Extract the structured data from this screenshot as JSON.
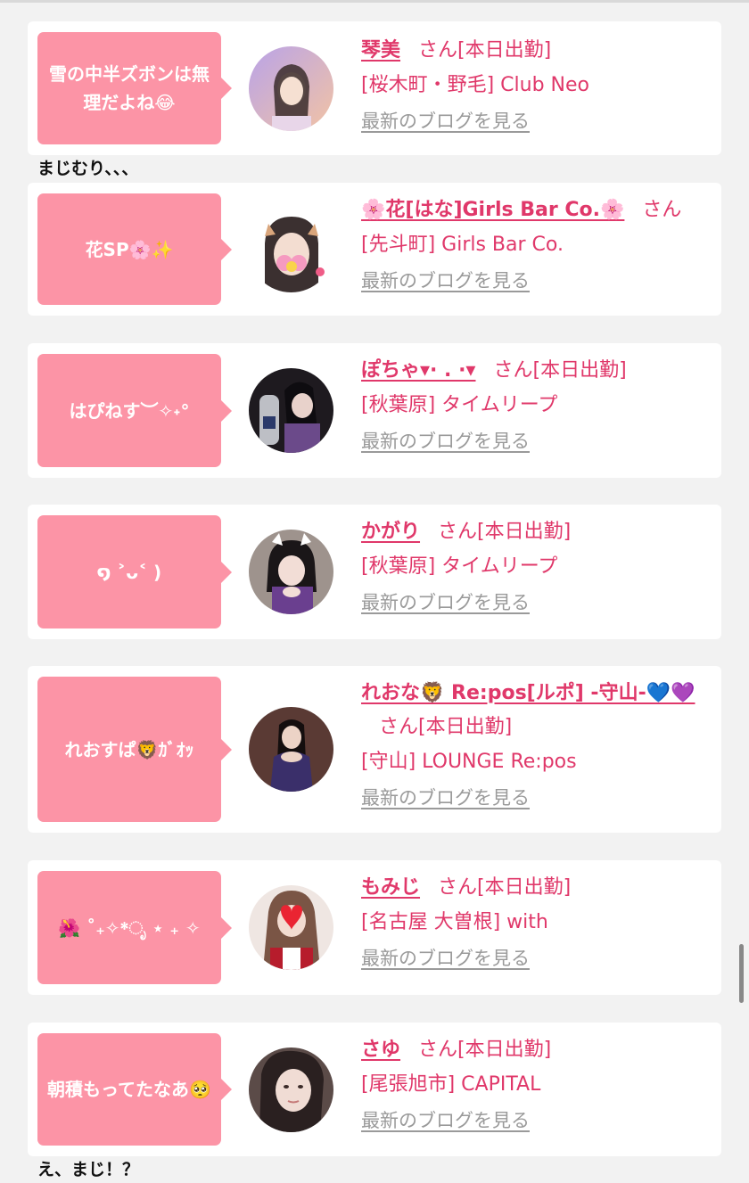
{
  "cards": [
    {
      "bubble": "雪の中半ズボンは無理だよね😂",
      "name": "琴美",
      "san": "さん[本日出勤]",
      "shop": "[桜木町・野毛] Club Neo",
      "blog": "最新のブログを見る"
    },
    {
      "bubble": "花SP🌸✨",
      "name": "🌸花[はな]Girls Bar Co.🌸",
      "san": "さん",
      "shop": "[先斗町] Girls Bar Co.",
      "blog": "最新のブログを見る"
    },
    {
      "bubble": "はぴねす︶✧˖°",
      "name": "ぽちゃ▾· . ·▾",
      "san": "さん[本日出勤]",
      "shop": "[秋葉原] タイムリープ",
      "blog": "最新のブログを見る"
    },
    {
      "bubble": "໑ ˃ᴗ˂ )",
      "name": "かがり",
      "san": "さん[本日出勤]",
      "shop": "[秋葉原] タイムリープ",
      "blog": "最新のブログを見る"
    },
    {
      "bubble": "れおすぱ🦁ｶﾞｵｯ",
      "name": "れおな🦁 Re:pos[ルポ] -守山-💙💜",
      "san": "さん[本日出勤]",
      "shop": "[守山] LOUNGE Re:pos",
      "blog": "最新のブログを見る"
    },
    {
      "bubble": "🌺 ˚₊✧*ೃ ⋆ ₊ ✧",
      "name": "もみじ",
      "san": "さん[本日出勤]",
      "shop": "[名古屋 大曽根] with",
      "blog": "最新のブログを見る"
    },
    {
      "bubble": "朝積もってたなあ🥺",
      "name": "さゆ",
      "san": "さん[本日出勤]",
      "shop": "[尾張旭市] CAPITAL",
      "blog": "最新のブログを見る"
    }
  ],
  "comments": [
    "まじむり、、、",
    "え、まじ！？"
  ],
  "colors": {
    "accent": "#e0386a",
    "bubble": "#fc94a6",
    "background": "#f2f2f2",
    "link_gray": "#9a9a9a"
  }
}
